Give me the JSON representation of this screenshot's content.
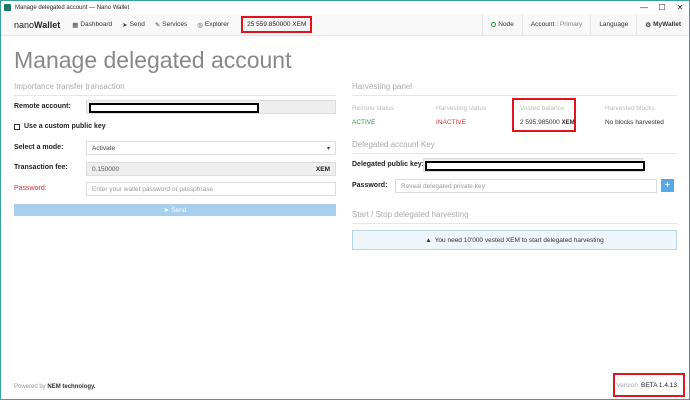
{
  "window": {
    "title": "Manage delegated account — Nano Wallet",
    "min": "—",
    "max": "☐",
    "close": "✕"
  },
  "nav": {
    "brand_light": "nano",
    "brand_bold": "Wallet",
    "dashboard": "Dashboard",
    "send": "Send",
    "services": "Services",
    "explorer": "Explorer",
    "balance": "25 559.850000 XEM",
    "node": "Node",
    "account_label": "Account :",
    "account_value": "Primary",
    "language": "Language",
    "mywallet": "MyWallet"
  },
  "page": {
    "title": "Manage delegated account"
  },
  "transfer": {
    "section_title": "Importance transfer transaction",
    "remote_account_label": "Remote account:",
    "custom_key_label": "Use a custom public key",
    "mode_label": "Select a mode:",
    "mode_value": "Activate",
    "fee_label": "Transaction fee:",
    "fee_value": "0.150000",
    "fee_unit": "XEM",
    "password_label": "Password:",
    "password_placeholder": "Enter your wallet password or passphrase",
    "send_button": "Send"
  },
  "harvesting": {
    "section_title": "Harvesting panel",
    "remote_status_h": "Remote status",
    "remote_status_v": "ACTIVE",
    "harvest_status_h": "Harvesting status",
    "harvest_status_v": "INACTIVE",
    "vested_h": "Vested balance",
    "vested_v": "2 595.985000",
    "vested_unit": "XEM",
    "blocks_h": "Harvested blocks",
    "blocks_v": "No blocks harvested"
  },
  "delegated_key": {
    "section_title": "Delegated account Key",
    "public_key_label": "Delegated public key:",
    "password_label": "Password:",
    "password_placeholder": "Reveal delegated private key",
    "plus": "+"
  },
  "startstop": {
    "section_title": "Start / Stop delegated harvesting",
    "alert_text": "You need 10'000 vested XEM to start delegated harvesting"
  },
  "footer": {
    "powered_prefix": "Powered by",
    "powered_brand": "NEM technology.",
    "version_label": "Version",
    "version_value": "BETA 1.4.13"
  },
  "colors": {
    "accent_red": "#e0141e",
    "active_green": "#2a9b3b",
    "inactive_red": "#d9333a",
    "send_blue": "#a8cfee"
  }
}
